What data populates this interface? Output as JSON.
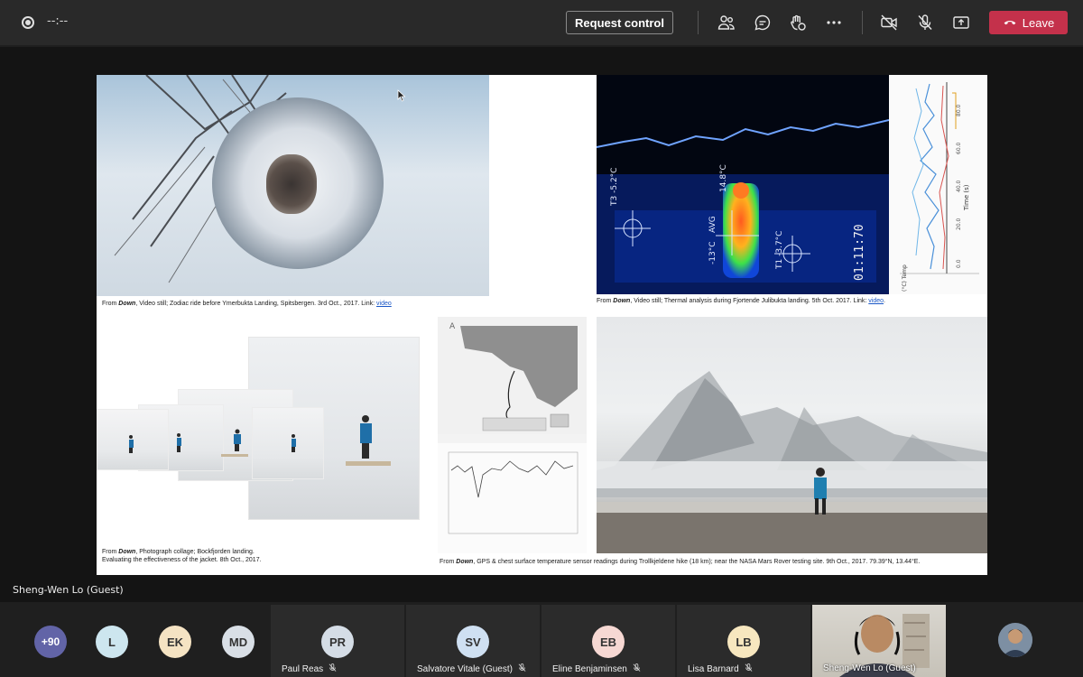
{
  "topbar": {
    "timer": "--:--",
    "request_control": "Request control",
    "leave": "Leave",
    "icons": [
      "record-icon",
      "people-icon",
      "chat-icon",
      "reactions-icon",
      "more-icon",
      "camera-off-icon",
      "mic-off-icon",
      "share-icon",
      "phone-icon"
    ]
  },
  "presenter": {
    "name": "Sheng-Wen Lo (Guest)"
  },
  "slide": {
    "captions": {
      "pano_prefix": "From ",
      "pano_title": "Down",
      "pano_text": ", Video still; Zodiac ride before Ymerbukta Landing, Spitsbergen. 3rd Oct., 2017. Link: ",
      "pano_link": "video",
      "thermal_prefix": "From ",
      "thermal_title": "Down",
      "thermal_text": ", Video still; Thermal analysis during Fjortende Julibukta landing. 5th Oct. 2017.  Link: ",
      "thermal_link": "video",
      "thermal_end": ".",
      "collage_prefix": "From ",
      "collage_title": "Down",
      "collage_text": ", Photograph collage; Bockfjorden landing.",
      "collage_line2": "Evaluating the effectiveness of the jacket. 8th Oct., 2017.",
      "gps_prefix": "From ",
      "gps_title": "Down",
      "gps_text": ", GPS & chest surface temperature sensor readings during Trollkjeldene hike (18 km); near the NASA Mars Rover testing site. 9th Oct., 2017.  79.39°N, 13.44°E."
    },
    "thermal": {
      "t3": "T3",
      "t3_val": "-5.2°C",
      "avg": "AVG",
      "avg_top": "14.8°C",
      "avg_low": "-13°C",
      "t1": "T1",
      "t1_val": "-3.7°C",
      "timecode": "01:11:70"
    },
    "graph": {
      "axis_label": "Time (s)",
      "temp_label": "(°C) Temp",
      "ticks": [
        "0.0",
        "20.0",
        "40.0",
        "60.0",
        "80.0"
      ]
    },
    "map": {
      "label": "A"
    }
  },
  "participants": {
    "overflow": "+90",
    "avatars": [
      {
        "initials": "L",
        "color": "#cde6ef"
      },
      {
        "initials": "EK",
        "color": "#f5e3c3"
      },
      {
        "initials": "MD",
        "color": "#d9dfe6"
      }
    ],
    "tiles": [
      {
        "initials": "PR",
        "name": "Paul Reas",
        "color": "#d5dde6"
      },
      {
        "initials": "SV",
        "name": "Salvatore Vitale (Guest)",
        "color": "#cfe0f2"
      },
      {
        "initials": "EB",
        "name": "Eline Benjaminsen",
        "color": "#f6d8d3"
      },
      {
        "initials": "LB",
        "name": "Lisa Barnard",
        "color": "#f7e7bf"
      }
    ],
    "camera_name": "Sheng-Wen Lo (Guest)"
  },
  "colors": {
    "leave": "#c4314b",
    "overflow": "#6264a7"
  }
}
